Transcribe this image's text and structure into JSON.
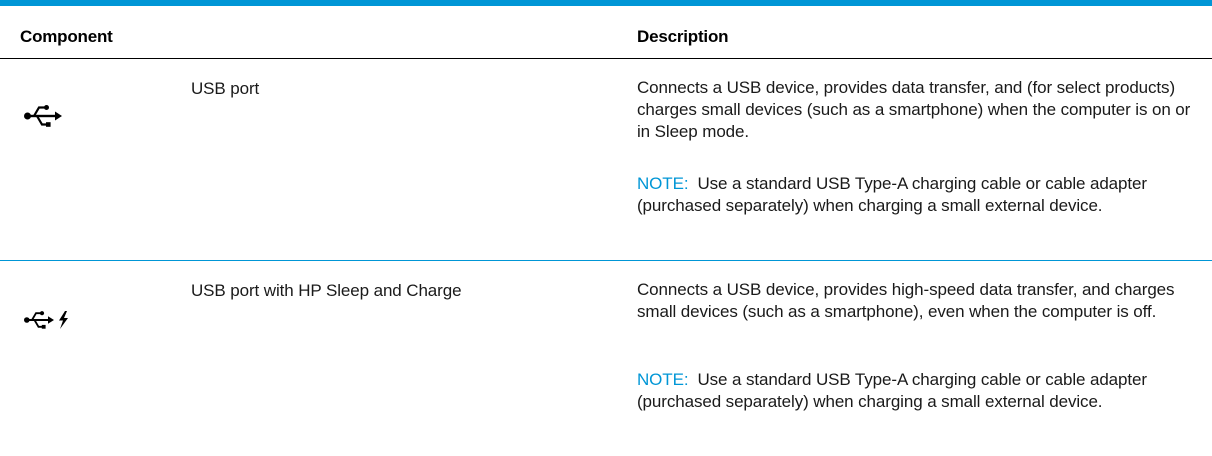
{
  "colors": {
    "accent": "#0096d6",
    "text": "#1a1a1a"
  },
  "table": {
    "headers": {
      "component": "Component",
      "description": "Description"
    },
    "rows": [
      {
        "icon": "usb-icon",
        "name": "USB port",
        "description": "Connects a USB device, provides data transfer, and (for select products) charges small devices (such as a smartphone) when the computer is on or in Sleep mode.",
        "note_label": "NOTE:",
        "note_text": "Use a standard USB Type-A charging cable or cable adapter (purchased separately) when charging a small external device."
      },
      {
        "icon": "usb-sleep-and-charge-icon",
        "name": "USB port with HP Sleep and Charge",
        "description": "Connects a USB device, provides high-speed data transfer, and charges small devices (such as a smartphone), even when the computer is off.",
        "note_label": "NOTE:",
        "note_text": "Use a standard USB Type-A charging cable or cable adapter (purchased separately) when charging a small external device."
      }
    ]
  }
}
